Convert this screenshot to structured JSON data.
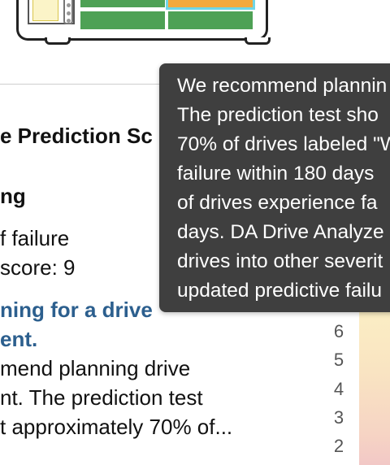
{
  "tooltip": {
    "lines": [
      "We recommend plannin",
      "The prediction test sho",
      "70% of drives labeled \"W",
      "failure within 180 days",
      "of drives experience fa",
      "days. DA Drive Analyze",
      "drives into other severit",
      "updated predictive failu"
    ]
  },
  "details": {
    "score_title": "e Prediction Sc",
    "severity": "ng",
    "risk_label": "f failure",
    "score_line": " score: 9",
    "link_line1": "ning for a drive",
    "link_line2": "ent.",
    "desc_line1": "mend planning drive",
    "desc_line2": "nt. The prediction test",
    "desc_line3": "t approximately 70% of..."
  },
  "score_axis": {
    "labels": [
      "6",
      "5",
      "4",
      "3",
      "2"
    ]
  },
  "colors": {
    "tooltip_bg": "#3f3f3f",
    "link": "#2c5f8e",
    "bay_green": "#4ea155",
    "bay_orange": "#f4a93c",
    "bay_highlight": "#6fd6e6"
  }
}
